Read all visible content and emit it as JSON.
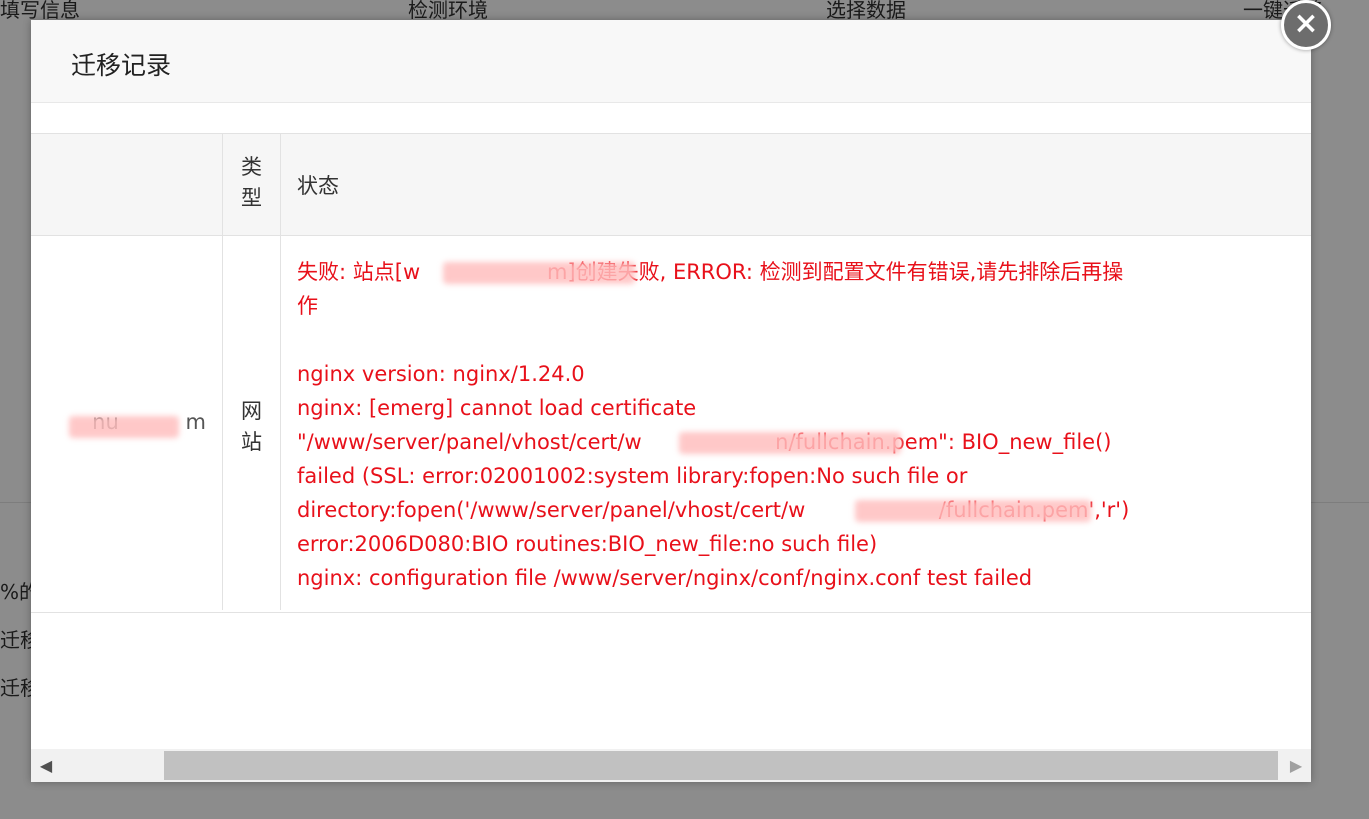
{
  "background": {
    "steps": [
      "填写信息",
      "检测环境",
      "选择数据",
      "一键迁移"
    ],
    "side_texts": [
      "%的",
      "迁移",
      "迁移"
    ]
  },
  "modal": {
    "title": "迁移记录",
    "close_label": "×"
  },
  "table": {
    "headers": {
      "name": "",
      "type": "类\n型",
      "status": "状态"
    },
    "rows": [
      {
        "name": "nu          m",
        "type": "网\n站",
        "status": "失败: 站点[w                   m]创建失败, ERROR: 检测到配置文件有错误,请先排除后再操\n作\n\nnginx version: nginx/1.24.0\nnginx: [emerg] cannot load certificate\n\"/www/server/panel/vhost/cert/w                    n/fullchain.pem\": BIO_new_file()\nfailed (SSL: error:02001002:system library:fopen:No such file or\ndirectory:fopen('/www/server/panel/vhost/cert/w                    /fullchain.pem','r')\nerror:2006D080:BIO routines:BIO_new_file:no such file)\nnginx: configuration file /www/server/nginx/conf/nginx.conf test failed"
      }
    ]
  },
  "scrollbar": {
    "left_arrow": "◀",
    "right_arrow": "▶"
  },
  "colors": {
    "error_text": "#e8101a",
    "header_bg": "#f8f8f8",
    "close_bg": "#6d6d6d"
  }
}
